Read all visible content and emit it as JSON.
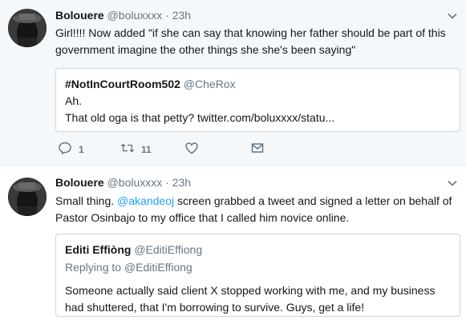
{
  "tweets": [
    {
      "name": "Bolouere",
      "handle": "@boluxxxx",
      "dot": "·",
      "time": "23h",
      "text": "Girl!!!! Now added \"if she can say that knowing her father should be part of this government imagine the other things she she's been saying\"",
      "quote": {
        "name": "#NotInCourtRoom502",
        "handle": "@CheRox",
        "line1": "Ah.",
        "line2": "That old oga is that petty? twitter.com/boluxxxx/statu..."
      },
      "actions": {
        "reply_count": "1",
        "retweet_count": "11"
      }
    },
    {
      "name": "Bolouere",
      "handle": "@boluxxxx",
      "dot": "·",
      "time": "23h",
      "text_before": "Small thing. ",
      "mention": "@akandeoj",
      "text_after": " screen grabbed a tweet and signed a letter on behalf of Pastor Osinbajo to my office that I called him novice online.",
      "quote": {
        "name": "Editi Effiòng",
        "handle": "@EditiEffiong",
        "replying_to": "Replying to @EditiEffiong",
        "body": "Someone actually said client X stopped working with me, and my business had shuttered, that I'm borrowing to survive. Guys, get a life!"
      }
    }
  ],
  "colors": {
    "accent": "#1da1f2",
    "muted": "#657786",
    "border": "#e6ecf0",
    "highlight_bg": "#f5f8fa"
  },
  "icons": [
    "reply-icon",
    "retweet-icon",
    "like-icon",
    "message-icon",
    "chevron-down-icon",
    "avatar"
  ]
}
